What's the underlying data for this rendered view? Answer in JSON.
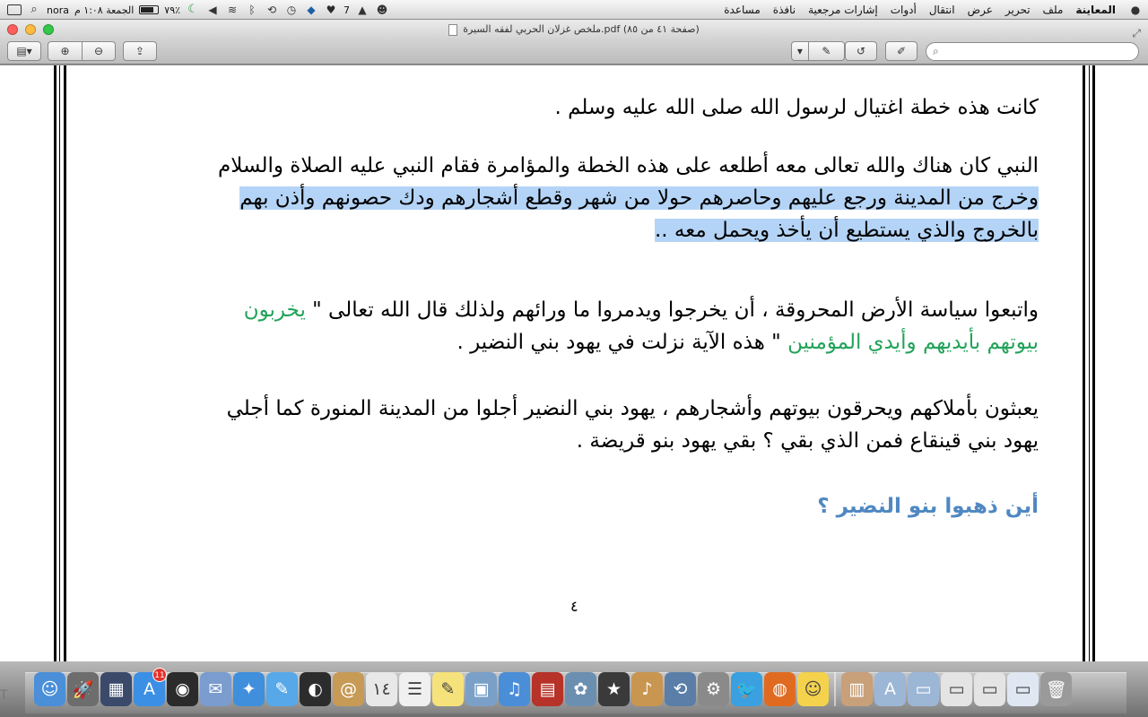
{
  "menubar": {
    "user": "nora",
    "clock": "الجمعة ١:٠٨ م",
    "battery_percent": "٧٩٪",
    "battery_level": 0.79,
    "notification_count": "7",
    "app_name": "المعاينة",
    "menus": [
      "ملف",
      "تحرير",
      "عرض",
      "انتقال",
      "أدوات",
      "إشارات مرجعية",
      "نافذة",
      "مساعدة"
    ],
    "status_icons": [
      "dropbox-icon",
      "twitter-icon",
      "adobe-icon",
      "smile-icon",
      "time-machine-icon",
      "bluetooth-icon",
      "wifi-icon",
      "volume-icon",
      "moon-icon"
    ]
  },
  "window": {
    "title": "ملخص غزلان الحربي لفقه السيرة.pdf (صفحة ٤١ من ٨٥)",
    "search_placeholder": ""
  },
  "document": {
    "paragraphs": [
      {
        "lines": [
          {
            "segments": [
              {
                "text": "كانت هذه خطة اغتيال لرسول الله صلى الله عليه وسلم .",
                "style": "normal"
              }
            ]
          }
        ]
      },
      {
        "lines": [
          {
            "segments": [
              {
                "text": "النبي كان هناك والله تعالى معه أطلعه على هذه الخطة والمؤامرة فقام النبي عليه الصلاة والسلام",
                "style": "normal"
              }
            ]
          },
          {
            "segments": [
              {
                "text": "وخرج من المدينة ورجع عليهم وحاصرهم حولا من شهر وقطع أشجارهم ودك حصونهم وأذن بهم",
                "style": "highlight"
              }
            ]
          },
          {
            "segments": [
              {
                "text": "بالخروج والذي يستطيع أن يأخذ ويحمل معه ..",
                "style": "highlight"
              }
            ]
          }
        ]
      },
      {
        "lines": [
          {
            "segments": [
              {
                "text": "واتبعوا سياسة الأرض المحروقة ، أن يخرجوا ويدمروا ما ورائهم ولذلك قال الله تعالى \" ",
                "style": "normal"
              },
              {
                "text": "يخربون",
                "style": "green"
              }
            ]
          },
          {
            "segments": [
              {
                "text": "بيوتهم بأيديهم وأيدي المؤمنين",
                "style": "green"
              },
              {
                "text": " \" هذه الآية نزلت في يهود بني النضير .",
                "style": "normal"
              }
            ]
          }
        ]
      },
      {
        "lines": [
          {
            "segments": [
              {
                "text": "يعبثون بأملاكهم ويحرقون بيوتهم وأشجارهم ، يهود بني النضير أجلوا من المدينة المنورة كما أجلي",
                "style": "normal"
              }
            ]
          },
          {
            "segments": [
              {
                "text": "يهود بني قينقاع فمن الذي بقي ؟ بقي يهود بنو قريضة .",
                "style": "normal"
              }
            ]
          }
        ]
      },
      {
        "lines": [
          {
            "segments": [
              {
                "text": "أين ذهبوا بنو النضير ؟",
                "style": "heading"
              }
            ]
          }
        ]
      }
    ],
    "page_number": "٤"
  },
  "dock": {
    "apps": [
      {
        "name": "finder",
        "glyph": "☺",
        "color": "#4a8fd8"
      },
      {
        "name": "launchpad",
        "glyph": "🚀",
        "color": "#6d6d6d"
      },
      {
        "name": "mission-control",
        "glyph": "▦",
        "color": "#3b4a6b"
      },
      {
        "name": "app-store",
        "glyph": "A",
        "color": "#3b8fe4",
        "badge": "11"
      },
      {
        "name": "dashboard",
        "glyph": "◉",
        "color": "#2b2b2b"
      },
      {
        "name": "mail",
        "glyph": "✉",
        "color": "#7a9ccf"
      },
      {
        "name": "safari",
        "glyph": "✦",
        "color": "#3f8fdc"
      },
      {
        "name": "messages",
        "glyph": "✎",
        "color": "#56a8e8"
      },
      {
        "name": "facetime",
        "glyph": "◐",
        "color": "#2c2c2c"
      },
      {
        "name": "contacts",
        "glyph": "@",
        "color": "#c79a55"
      },
      {
        "name": "calendar",
        "glyph": "١٤",
        "color": "#e8e8e8"
      },
      {
        "name": "reminders",
        "glyph": "☰",
        "color": "#f0f0f0"
      },
      {
        "name": "notes",
        "glyph": "✎",
        "color": "#f6e27a"
      },
      {
        "name": "preview",
        "glyph": "▣",
        "color": "#7aa0c8"
      },
      {
        "name": "itunes",
        "glyph": "♫",
        "color": "#4b8ed8"
      },
      {
        "name": "photo-booth",
        "glyph": "▤",
        "color": "#b73228"
      },
      {
        "name": "iphoto",
        "glyph": "✿",
        "color": "#6b8fb0"
      },
      {
        "name": "imovie",
        "glyph": "★",
        "color": "#3a3a3a"
      },
      {
        "name": "garageband",
        "glyph": "♪",
        "color": "#c89650"
      },
      {
        "name": "time-machine",
        "glyph": "⟲",
        "color": "#5a7ea8"
      },
      {
        "name": "system-preferences",
        "glyph": "⚙",
        "color": "#8a8a8a"
      },
      {
        "name": "twitter",
        "glyph": "🐦",
        "color": "#3aa0e0"
      },
      {
        "name": "firefox",
        "glyph": "◍",
        "color": "#e06b20"
      },
      {
        "name": "emoji-app",
        "glyph": "☺",
        "color": "#f4d24c"
      },
      {
        "name": "archive",
        "glyph": "▥",
        "color": "#c8a07a"
      },
      {
        "name": "applications-folder",
        "glyph": "A",
        "color": "#9cb6d6"
      },
      {
        "name": "documents-folder",
        "glyph": "▭",
        "color": "#9cb6d6"
      },
      {
        "name": "downloads-stack",
        "glyph": "▭",
        "color": "#e4e4e4"
      },
      {
        "name": "window-stack-1",
        "glyph": "▭",
        "color": "#e4e4e4"
      },
      {
        "name": "window-stack-2",
        "glyph": "▭",
        "color": "#dfe8f2"
      },
      {
        "name": "trash",
        "glyph": "🗑",
        "color": "#9a9a9a"
      }
    ]
  }
}
